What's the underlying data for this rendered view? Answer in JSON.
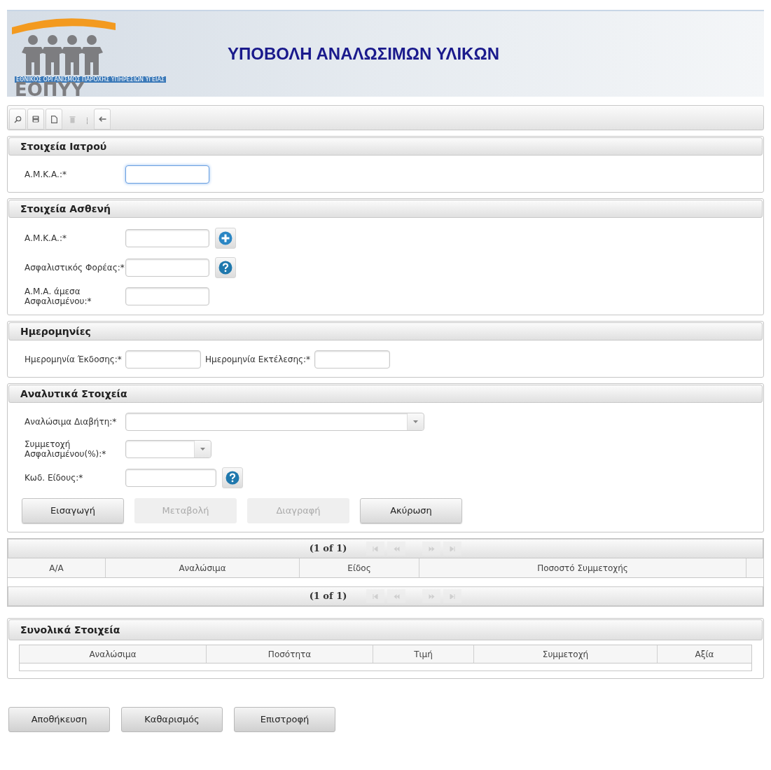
{
  "header": {
    "logo_tagline": "ΕΘΝΙΚΟΣ ΟΡΓΑΝΙΣΜΟΣ ΠΑΡΟΧΗΣ ΥΠΗΡΕΣΙΩΝ ΥΓΕΙΑΣ",
    "logo_text": "ΕΟΠΥΥ",
    "title": "ΥΠΟΒΟΛΗ ΑΝΑΛΩΣΙΜΩΝ ΥΛΙΚΩΝ"
  },
  "toolbar": [
    {
      "kind": "search",
      "disabled": false
    },
    {
      "kind": "save",
      "disabled": false
    },
    {
      "kind": "new",
      "disabled": false
    },
    {
      "kind": "delete",
      "disabled": true
    },
    {
      "kind": "separator"
    },
    {
      "kind": "back",
      "disabled": false
    }
  ],
  "sections": [
    {
      "title": "Στοιχεία Ιατρού",
      "rows": [
        [
          {
            "label": "Α.Μ.Κ.Α.:*",
            "kind": "text",
            "focused": true
          }
        ]
      ]
    },
    {
      "title": "Στοιχεία Ασθενή",
      "rows": [
        [
          {
            "label": "Α.Μ.Κ.Α.:*",
            "kind": "text",
            "focused": false,
            "addon": {
              "kind": "add"
            }
          }
        ],
        [
          {
            "label": "Ασφαλιστικός Φορέας:*",
            "kind": "text",
            "focused": false,
            "addon": {
              "kind": "help"
            }
          }
        ],
        [
          {
            "label": "Α.Μ.Α. άμεσα Ασφαλισμένου:*",
            "kind": "text",
            "focused": false
          }
        ]
      ]
    },
    {
      "title": "Ημερομηνίες",
      "rows": [
        [
          {
            "label": "Ημερομηνία Έκδοσης:*",
            "kind": "date",
            "focused": false
          },
          {
            "label": "Ημερομηνία Εκτέλεσης:*",
            "kind": "date",
            "focused": false
          }
        ]
      ]
    },
    {
      "title": "Αναλυτικά Στοιχεία",
      "rows": [
        [
          {
            "label": "Αναλώσιμα Διαβήτη:*",
            "kind": "wide_select",
            "focused": false
          }
        ],
        [
          {
            "label": "Συμμετοχή Ασφαλισμένου(%):*",
            "kind": "short_select",
            "focused": false
          }
        ],
        [
          {
            "label": "Κωδ. Είδους:*",
            "kind": "code",
            "focused": false,
            "addon": {
              "kind": "help"
            }
          }
        ]
      ],
      "buttons": [
        {
          "label": "Εισαγωγή",
          "disabled": false
        },
        {
          "label": "Μεταβολή",
          "disabled": true
        },
        {
          "label": "Διαγραφή",
          "disabled": true
        },
        {
          "label": "Ακύρωση",
          "disabled": false
        }
      ]
    }
  ],
  "grid": {
    "top_pager": {
      "text": "(1 of 1)",
      "buttons": [
        {
          "kind": "first",
          "disabled": true
        },
        {
          "kind": "prev",
          "disabled": true
        },
        {
          "kind": "next",
          "disabled": true
        },
        {
          "kind": "last",
          "disabled": true
        }
      ]
    },
    "columns": [
      "Α/Α",
      "Αναλώσιμα",
      "Είδος",
      "Ποσοστό Συμμετοχής"
    ],
    "bottom_pager": {
      "text": "(1 of 1)",
      "buttons": [
        {
          "kind": "first",
          "disabled": true
        },
        {
          "kind": "prev",
          "disabled": true
        },
        {
          "kind": "next",
          "disabled": true
        },
        {
          "kind": "last",
          "disabled": true
        }
      ]
    }
  },
  "totals": {
    "title": "Συνολικά Στοιχεία",
    "columns": [
      "Αναλώσιμα",
      "Ποσότητα",
      "Τιμή",
      "Συμμετοχή",
      "Αξία"
    ]
  },
  "footer_buttons": [
    "Αποθήκευση",
    "Καθαρισμός",
    "Επιστροφή"
  ]
}
